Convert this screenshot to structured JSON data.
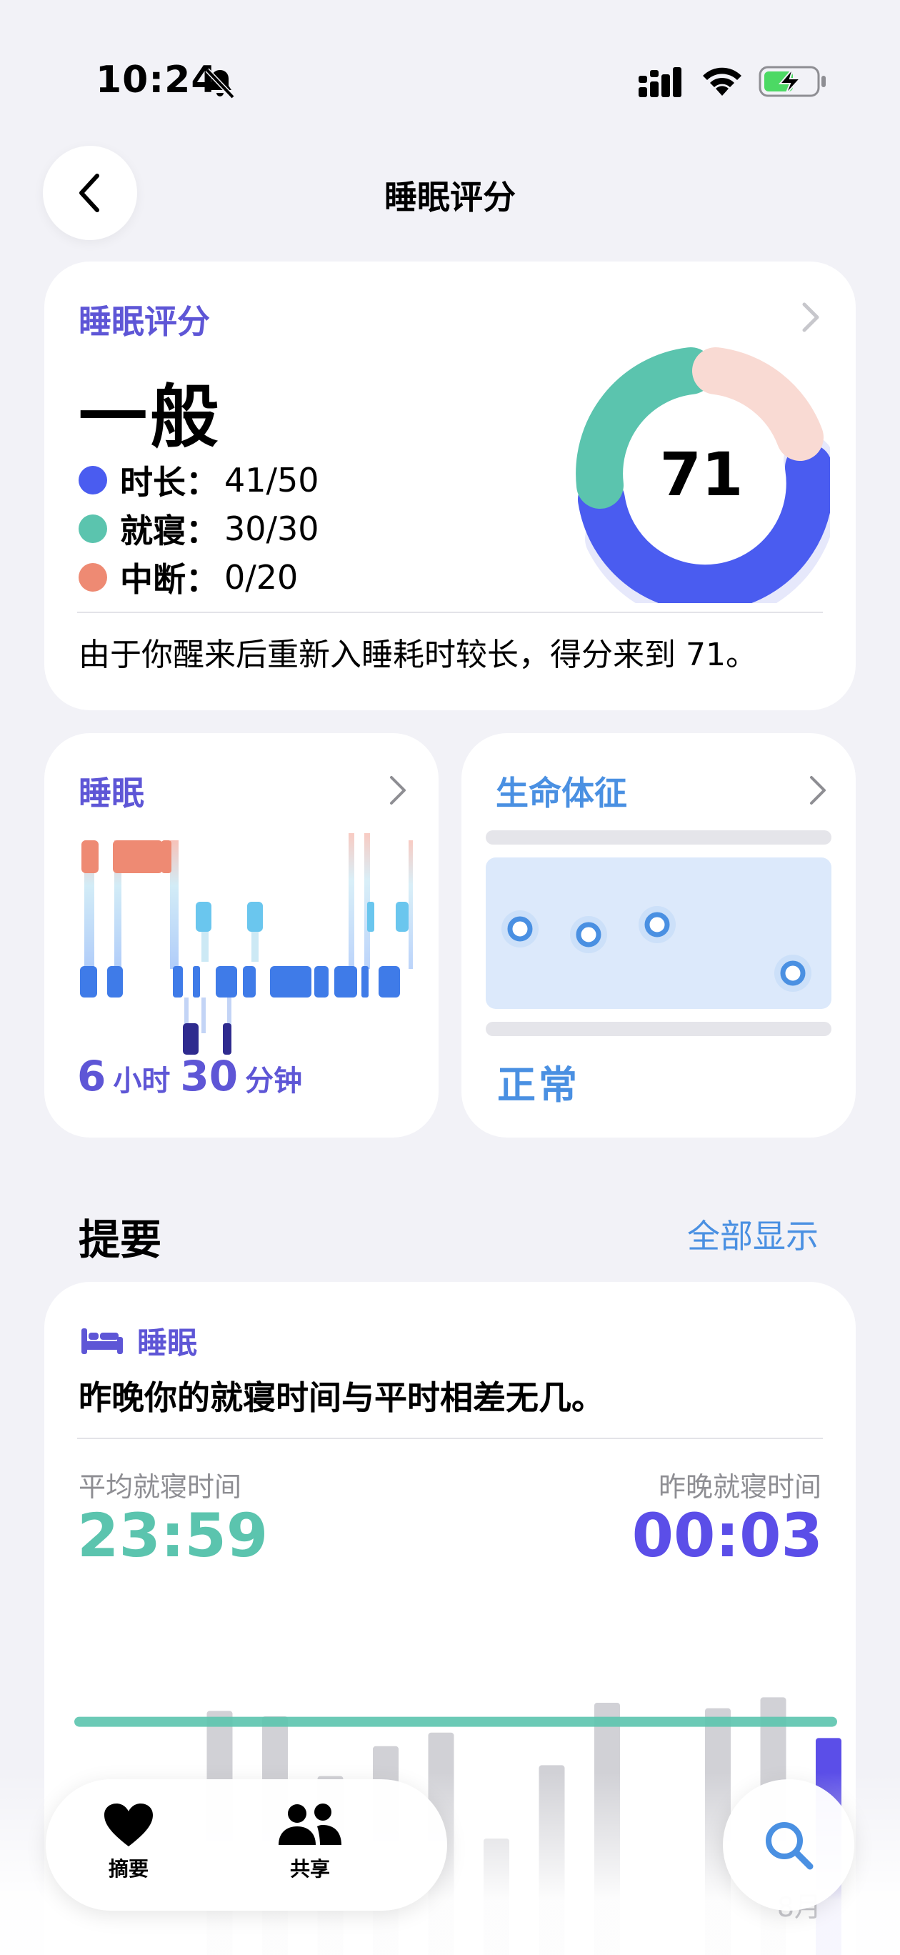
{
  "status_bar": {
    "time": "10:24",
    "icons": [
      "bell-slash-icon",
      "signal-icon",
      "wifi-icon",
      "battery-charging-icon"
    ]
  },
  "nav": {
    "title": "睡眠评分",
    "back_icon": "chevron-left-icon"
  },
  "score_card": {
    "title": "睡眠评分",
    "level": "一般",
    "score": "71",
    "breakdown": [
      {
        "name": "时长：",
        "value": "41/50",
        "color": "#4a5cf0",
        "earned": 41,
        "max": 50
      },
      {
        "name": "就寝：",
        "value": "30/30",
        "color": "#5bc4ae",
        "earned": 30,
        "max": 30
      },
      {
        "name": "中断：",
        "value": "0/20",
        "color": "#ee8a73",
        "earned": 0,
        "max": 20
      }
    ],
    "description": "由于你醒来后重新入睡耗时较长，得分来到 71。"
  },
  "sleep_card": {
    "title": "睡眠",
    "hours": "6",
    "hours_unit": "小时",
    "minutes": "30",
    "minutes_unit": "分钟"
  },
  "vitals_card": {
    "title": "生命体征",
    "status": "正常"
  },
  "summary": {
    "section_title": "提要",
    "show_all": "全部显示",
    "category": "睡眠",
    "category_icon": "bed-icon",
    "text": "昨晚你的就寝时间与平时相差无几。",
    "avg_label": "平均就寝时间",
    "avg_value": "23:59",
    "last_label": "昨晚就寝时间",
    "last_value": "00:03"
  },
  "chart_data": {
    "type": "bar",
    "bar_heights": [
      0,
      0.92,
      0.9,
      0.68,
      0.79,
      0.84,
      0.45,
      0.72,
      0.95,
      0,
      0.93,
      0.97,
      0.82
    ],
    "highlight_index": 12,
    "average_level": 0.88,
    "colors": {
      "bar": "#d1d1d6",
      "highlight": "#5b4ee8",
      "average_line": "#5bc4ae"
    },
    "x_labels": [
      "",
      "8月"
    ]
  },
  "tab_bar": {
    "tabs": [
      {
        "label": "摘要",
        "icon": "heart-icon"
      },
      {
        "label": "共享",
        "icon": "people-icon"
      }
    ],
    "search_icon": "search-icon"
  },
  "colors": {
    "accent_purple": "#5e56d6",
    "accent_blue": "#4a90e2",
    "teal": "#5bc4ae",
    "coral": "#ee8a73",
    "background": "#f2f2f7"
  }
}
